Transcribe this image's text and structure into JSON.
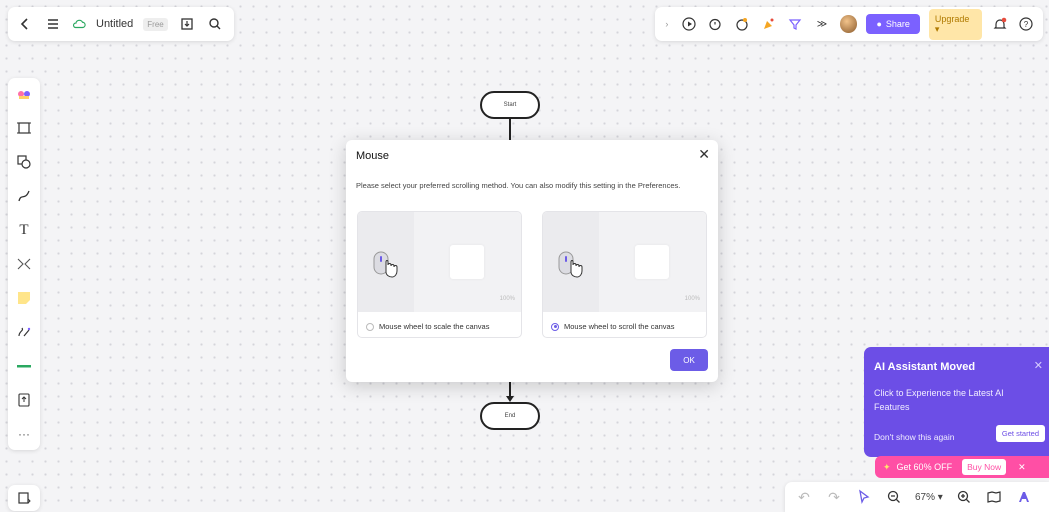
{
  "topbar_left": {
    "title": "Untitled",
    "badge": "Free",
    "icons": [
      "back-icon",
      "menu-icon",
      "cloud-icon",
      "save-icon",
      "search-icon"
    ]
  },
  "topbar_right": {
    "share_label": "Share",
    "upgrade_label": "Upgrade ▾",
    "icons": [
      "play-icon",
      "timer-icon",
      "reaction-icon",
      "celebrate-icon",
      "filter-icon",
      "more-icon",
      "avatar",
      "notification-icon",
      "help-icon"
    ]
  },
  "left_toolbar": {
    "icons": [
      "template-icon",
      "frame-icon",
      "shape-icon",
      "pen-icon",
      "text-icon",
      "connector-icon",
      "sticky-note-icon",
      "draw-icon",
      "line-icon",
      "upload-icon",
      "more-tools-icon"
    ]
  },
  "flowchart": {
    "start_label": "Start",
    "end_label": "End"
  },
  "modal": {
    "title": "Mouse",
    "description": "Please select your preferred scrolling method. You can also modify this setting in the Preferences.",
    "option_scale_label": "Mouse wheel to scale the canvas",
    "option_scroll_label": "Mouse wheel to scroll the canvas",
    "zoom_hint": "100%",
    "selected_option": "scroll",
    "ok_label": "OK"
  },
  "ai_popup": {
    "title": "AI Assistant Moved",
    "description": "Click to Experience the Latest AI Features",
    "dont_show": "Don't show this again",
    "get_started": "Get started"
  },
  "promo": {
    "offer": "Get 60% OFF",
    "buy_now": "Buy Now"
  },
  "bottom_toolbar": {
    "zoom": "67%"
  },
  "colors": {
    "accent": "#6c5ce7",
    "ai_popup_bg": "#6c4ee6",
    "promo_bg": "#ff4fa5",
    "upgrade_bg": "#ffe6a8"
  }
}
